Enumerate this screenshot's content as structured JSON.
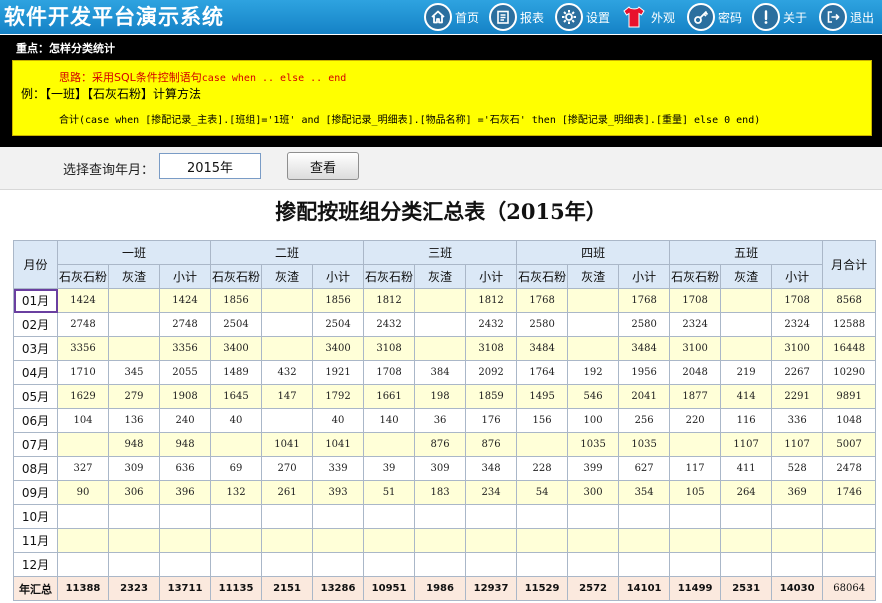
{
  "app": {
    "title": "软件开发平台演示系统"
  },
  "nav": [
    {
      "label": "首页",
      "icon": "home-icon"
    },
    {
      "label": "报表",
      "icon": "report-icon"
    },
    {
      "label": "设置",
      "icon": "gear-icon"
    },
    {
      "label": "外观",
      "icon": "tshirt-icon"
    },
    {
      "label": "密码",
      "icon": "key-icon"
    },
    {
      "label": "关于",
      "icon": "info-icon"
    },
    {
      "label": "退出",
      "icon": "logout-icon"
    }
  ],
  "tip": {
    "heading": "重点：怎样分类统计",
    "idea_label": "思路：采用SQL条件控制语句",
    "idea_code": "case when .. else .. end",
    "example": "例：【一班】【石灰石粉】计算方法",
    "formula": "合计(case when [掺配记录_主表].[班组]='1班' and [掺配记录_明细表].[物品名称] ='石灰石' then [掺配记录_明细表].[重量] else 0 end)"
  },
  "query": {
    "label": "选择查询年月：",
    "value": "2015年",
    "button": "查看"
  },
  "report": {
    "title": "掺配按班组分类汇总表（2015年）",
    "month_header": "月份",
    "total_header": "月合计",
    "groups": [
      "一班",
      "二班",
      "三班",
      "四班",
      "五班"
    ],
    "sub_headers": [
      "石灰石粉",
      "灰渣",
      "小计"
    ],
    "rows": [
      {
        "month": "01月",
        "cells": [
          "1424",
          "",
          "1424",
          "1856",
          "",
          "1856",
          "1812",
          "",
          "1812",
          "1768",
          "",
          "1768",
          "1708",
          "",
          "1708"
        ],
        "total": "8568"
      },
      {
        "month": "02月",
        "cells": [
          "2748",
          "",
          "2748",
          "2504",
          "",
          "2504",
          "2432",
          "",
          "2432",
          "2580",
          "",
          "2580",
          "2324",
          "",
          "2324"
        ],
        "total": "12588"
      },
      {
        "month": "03月",
        "cells": [
          "3356",
          "",
          "3356",
          "3400",
          "",
          "3400",
          "3108",
          "",
          "3108",
          "3484",
          "",
          "3484",
          "3100",
          "",
          "3100"
        ],
        "total": "16448"
      },
      {
        "month": "04月",
        "cells": [
          "1710",
          "345",
          "2055",
          "1489",
          "432",
          "1921",
          "1708",
          "384",
          "2092",
          "1764",
          "192",
          "1956",
          "2048",
          "219",
          "2267"
        ],
        "total": "10290"
      },
      {
        "month": "05月",
        "cells": [
          "1629",
          "279",
          "1908",
          "1645",
          "147",
          "1792",
          "1661",
          "198",
          "1859",
          "1495",
          "546",
          "2041",
          "1877",
          "414",
          "2291"
        ],
        "total": "9891"
      },
      {
        "month": "06月",
        "cells": [
          "104",
          "136",
          "240",
          "40",
          "",
          "40",
          "140",
          "36",
          "176",
          "156",
          "100",
          "256",
          "220",
          "116",
          "336"
        ],
        "total": "1048"
      },
      {
        "month": "07月",
        "cells": [
          "",
          "948",
          "948",
          "",
          "1041",
          "1041",
          "",
          "876",
          "876",
          "",
          "1035",
          "1035",
          "",
          "1107",
          "1107"
        ],
        "total": "5007"
      },
      {
        "month": "08月",
        "cells": [
          "327",
          "309",
          "636",
          "69",
          "270",
          "339",
          "39",
          "309",
          "348",
          "228",
          "399",
          "627",
          "117",
          "411",
          "528"
        ],
        "total": "2478"
      },
      {
        "month": "09月",
        "cells": [
          "90",
          "306",
          "396",
          "132",
          "261",
          "393",
          "51",
          "183",
          "234",
          "54",
          "300",
          "354",
          "105",
          "264",
          "369"
        ],
        "total": "1746"
      },
      {
        "month": "10月",
        "cells": [
          "",
          "",
          "",
          "",
          "",
          "",
          "",
          "",
          "",
          "",
          "",
          "",
          "",
          "",
          ""
        ],
        "total": ""
      },
      {
        "month": "11月",
        "cells": [
          "",
          "",
          "",
          "",
          "",
          "",
          "",
          "",
          "",
          "",
          "",
          "",
          "",
          "",
          ""
        ],
        "total": ""
      },
      {
        "month": "12月",
        "cells": [
          "",
          "",
          "",
          "",
          "",
          "",
          "",
          "",
          "",
          "",
          "",
          "",
          "",
          "",
          ""
        ],
        "total": ""
      }
    ],
    "footer": {
      "label": "年汇总",
      "cells": [
        "11388",
        "2323",
        "13711",
        "11135",
        "2151",
        "13286",
        "10951",
        "1986",
        "12937",
        "11529",
        "2572",
        "14101",
        "11499",
        "2531",
        "14030"
      ],
      "total": "68064"
    }
  }
}
